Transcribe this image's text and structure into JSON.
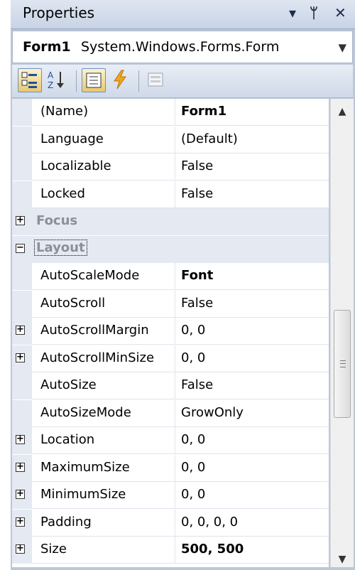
{
  "window": {
    "title": "Properties"
  },
  "titlebar_icons": {
    "dropdown": "dropdown-arrow-icon",
    "pin": "pin-icon",
    "close": "close-icon"
  },
  "object_selector": {
    "name": "Form1",
    "type": "System.Windows.Forms.Form"
  },
  "toolbar": {
    "buttons": [
      "categorized-icon",
      "alphabetical-icon",
      "properties-icon",
      "events-icon",
      "property-pages-icon"
    ],
    "active": [
      "categorized-icon",
      "properties-icon"
    ]
  },
  "grid": {
    "rows": [
      {
        "kind": "prop",
        "name": "(Name)",
        "value": "Form1",
        "value_bold": true
      },
      {
        "kind": "prop",
        "name": "Language",
        "value": "(Default)"
      },
      {
        "kind": "prop",
        "name": "Localizable",
        "value": "False"
      },
      {
        "kind": "prop",
        "name": "Locked",
        "value": "False"
      },
      {
        "kind": "category",
        "name": "Focus",
        "expander": "+"
      },
      {
        "kind": "category",
        "name": "Layout",
        "expander": "−",
        "focused": true
      },
      {
        "kind": "prop",
        "name": "AutoScaleMode",
        "value": "Font",
        "value_bold": true
      },
      {
        "kind": "prop",
        "name": "AutoScroll",
        "value": "False"
      },
      {
        "kind": "prop",
        "name": "AutoScrollMargin",
        "value": "0, 0",
        "expander": "+"
      },
      {
        "kind": "prop",
        "name": "AutoScrollMinSize",
        "value": "0, 0",
        "expander": "+"
      },
      {
        "kind": "prop",
        "name": "AutoSize",
        "value": "False"
      },
      {
        "kind": "prop",
        "name": "AutoSizeMode",
        "value": "GrowOnly"
      },
      {
        "kind": "prop",
        "name": "Location",
        "value": "0, 0",
        "expander": "+"
      },
      {
        "kind": "prop",
        "name": "MaximumSize",
        "value": "0, 0",
        "expander": "+"
      },
      {
        "kind": "prop",
        "name": "MinimumSize",
        "value": "0, 0",
        "expander": "+"
      },
      {
        "kind": "prop",
        "name": "Padding",
        "value": "0, 0, 0, 0",
        "expander": "+"
      },
      {
        "kind": "prop",
        "name": "Size",
        "value": "500, 500",
        "value_bold": true,
        "expander": "+"
      }
    ]
  },
  "colors": {
    "accent": "#6e8fc3",
    "category_bg": "#e4e9f2",
    "category_text": "#8a8f98"
  }
}
